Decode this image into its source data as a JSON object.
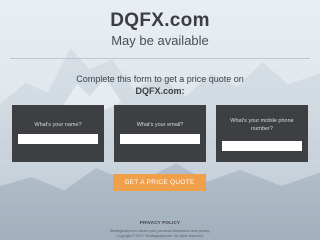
{
  "header": {
    "domain": "DQFX.com",
    "availability": "May be available"
  },
  "intro": {
    "line1": "Complete this form to get a price quote on",
    "domain_bold": "DQFX.com:"
  },
  "form": {
    "fields": [
      {
        "label": "What's your name?",
        "value": ""
      },
      {
        "label": "What's your email?",
        "value": ""
      },
      {
        "label": "What's your mobile phone number?",
        "value": ""
      }
    ],
    "submit_label": "GET A PRICE QUOTE"
  },
  "footer": {
    "privacy_label": "PRIVACY POLICY",
    "line1": "Strategically.com values your personal information and privacy.",
    "line2": "Copyright © 2017 Strategically.com. All rights reserved."
  },
  "colors": {
    "box_bg": "#3d3f42",
    "cta_bg": "#f0a04b",
    "title": "#3b3f44"
  }
}
